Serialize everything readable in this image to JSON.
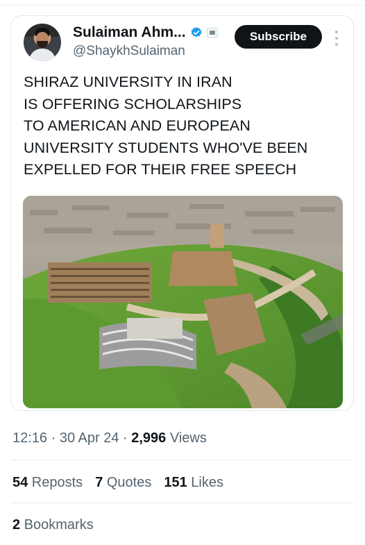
{
  "author": {
    "display_name": "Sulaiman Ahm...",
    "handle": "@ShaykhSulaiman",
    "verified_icon": "verified-badge-icon",
    "affiliation_icon": "affiliation-badge-icon"
  },
  "actions": {
    "subscribe_label": "Subscribe"
  },
  "tweet": {
    "lines": [
      "SHIRAZ UNIVERSITY IN IRAN",
      "IS OFFERING SCHOLARSHIPS",
      "TO AMERICAN AND EUROPEAN",
      "UNIVERSITY STUDENTS WHO'VE BEEN",
      "EXPELLED FOR THEIR FREE SPEECH"
    ]
  },
  "meta": {
    "time": "12:16",
    "sep1": " · ",
    "date": "30 Apr 24",
    "sep2": " · ",
    "views_count": "2,996",
    "views_label": " Views"
  },
  "stats": {
    "reposts_count": "54",
    "reposts_label": " Reposts",
    "quotes_count": "7",
    "quotes_label": " Quotes",
    "likes_count": "151",
    "likes_label": " Likes",
    "bookmarks_count": "2",
    "bookmarks_label": " Bookmarks"
  },
  "colors": {
    "text_primary": "#0f1419",
    "text_secondary": "#536471",
    "verified": "#1d9bf0",
    "button_bg": "#0f1419"
  }
}
